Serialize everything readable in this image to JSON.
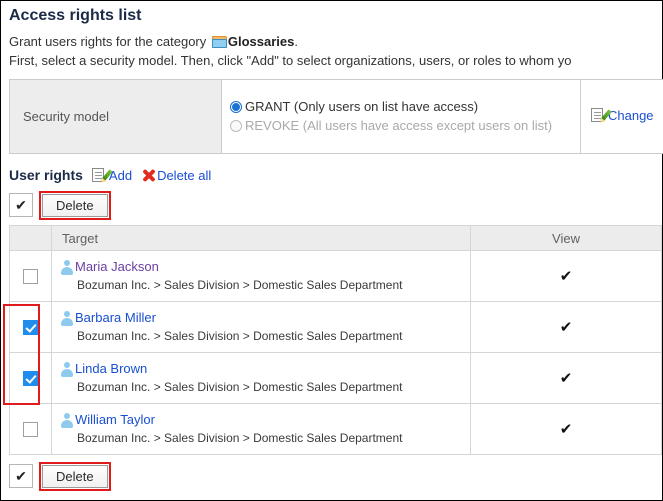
{
  "page": {
    "title": "Access rights list",
    "description_line1_prefix": "Grant users rights for the category ",
    "description_category": "Glossaries",
    "description_line1_suffix": ".",
    "description_line2": "First, select a security model. Then, click \"Add\" to select organizations, users, or roles to whom yo"
  },
  "security_model": {
    "label": "Security model",
    "options": [
      {
        "label": "GRANT (Only users on list have access)",
        "selected": true
      },
      {
        "label": "REVOKE (All users have access except users on list)",
        "selected": false
      }
    ],
    "change_label": "Change",
    "change_icon": "document-edit-icon"
  },
  "user_rights": {
    "title": "User rights",
    "add_label": "Add",
    "add_icon": "document-edit-icon",
    "delete_all_label": "Delete all",
    "delete_all_icon": "red-x-icon",
    "toolbar_top": {
      "select_all_icon": "check-icon",
      "delete_label": "Delete",
      "highlighted": true
    },
    "toolbar_bottom": {
      "select_all_icon": "check-icon",
      "delete_label": "Delete",
      "highlighted": true
    },
    "columns": [
      "",
      "Target",
      "View"
    ],
    "rows": [
      {
        "checked": false,
        "name": "Maria Jackson",
        "visited": true,
        "path": "Bozuman Inc. > Sales Division > Domestic Sales Department",
        "view": "✔"
      },
      {
        "checked": true,
        "name": "Barbara Miller",
        "visited": false,
        "path": "Bozuman Inc. > Sales Division > Domestic Sales Department",
        "view": "✔"
      },
      {
        "checked": true,
        "name": "Linda Brown",
        "visited": false,
        "path": "Bozuman Inc. > Sales Division > Domestic Sales Department",
        "view": "✔"
      },
      {
        "checked": false,
        "name": "William Taylor",
        "visited": false,
        "path": "Bozuman Inc. > Sales Division > Domestic Sales Department",
        "view": "✔"
      }
    ]
  },
  "colors": {
    "accent_link": "#1a4fd1",
    "visited_link": "#6b3fa0",
    "highlight_red": "#e01b1b",
    "checkbox_blue": "#1f8ded",
    "header_grey": "#ececec"
  },
  "icons": {
    "check": "✔",
    "folder": "folder-icon"
  }
}
